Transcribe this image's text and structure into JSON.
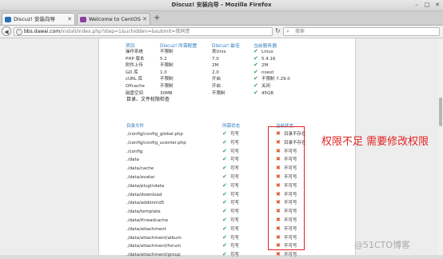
{
  "window": {
    "title": "Discuz! 安装向导 - Mozilla Firefox"
  },
  "tabs": [
    {
      "label": "Discuz! 安装向导",
      "active": true
    },
    {
      "label": "Welcome to CentOS",
      "active": false
    }
  ],
  "nav": {
    "url_domain": "bbs.dawai.com",
    "url_path": "/install/index.php?step=1&uchidden=&submit=我同意",
    "search_placeholder": "搜索"
  },
  "env_check": {
    "headers": [
      "项目",
      "Discuz! 所需配置",
      "Discuz! 最佳",
      "当前服务器"
    ],
    "rows": [
      {
        "item": "操作系统",
        "required": "不限制",
        "best": "类Unix",
        "current": "Linux"
      },
      {
        "item": "PHP 版本",
        "required": "5.2",
        "best": "7.0",
        "current": "5.4.16"
      },
      {
        "item": "附件上传",
        "required": "不限制",
        "best": "2M",
        "current": "2M"
      },
      {
        "item": "GD 库",
        "required": "1.0",
        "best": "2.0",
        "current": "noext"
      },
      {
        "item": "cURL 库",
        "required": "不限制",
        "best": "开启",
        "current": "不限制 7.29.0"
      },
      {
        "item": "OPcache",
        "required": "不限制",
        "best": "开启",
        "current": "关闭"
      },
      {
        "item": "磁盘空间",
        "required": "30MB",
        "best": "不限制",
        "current": "45GB"
      }
    ]
  },
  "perm_check": {
    "title": "目录、文件权限检查",
    "headers": [
      "目录文件",
      "所需状态",
      "当前状态"
    ],
    "rows": [
      {
        "path": "./config/config_global.php",
        "required": "可写",
        "current": "目录不存在"
      },
      {
        "path": "./config/config_ucenter.php",
        "required": "可写",
        "current": "目录不存在"
      },
      {
        "path": "./config",
        "required": "可写",
        "current": "不可写"
      },
      {
        "path": "./data",
        "required": "可写",
        "current": "不可写"
      },
      {
        "path": "./data/cache",
        "required": "可写",
        "current": "不可写"
      },
      {
        "path": "./data/avatar",
        "required": "可写",
        "current": "不可写"
      },
      {
        "path": "./data/plugindata",
        "required": "可写",
        "current": "不可写"
      },
      {
        "path": "./data/download",
        "required": "可写",
        "current": "不可写"
      },
      {
        "path": "./data/addonmd5",
        "required": "可写",
        "current": "不可写"
      },
      {
        "path": "./data/template",
        "required": "可写",
        "current": "不可写"
      },
      {
        "path": "./data/threadcache",
        "required": "可写",
        "current": "不可写"
      },
      {
        "path": "./data/attachment",
        "required": "可写",
        "current": "不可写"
      },
      {
        "path": "./data/attachment/album",
        "required": "可写",
        "current": "不可写"
      },
      {
        "path": "./data/attachment/forum",
        "required": "可写",
        "current": "不可写"
      },
      {
        "path": "./data/attachment/group",
        "required": "可写",
        "current": "不可写"
      }
    ]
  },
  "annotation": "权限不足  需要修改权限",
  "watermark": "@51CTO博客",
  "colors": {
    "ok": "#2ea34a",
    "error": "#e04a1f",
    "header": "#2e7bbd",
    "annotation": "#e32222"
  },
  "icons": {
    "ok": "check-icon",
    "error": "cross-icon"
  }
}
